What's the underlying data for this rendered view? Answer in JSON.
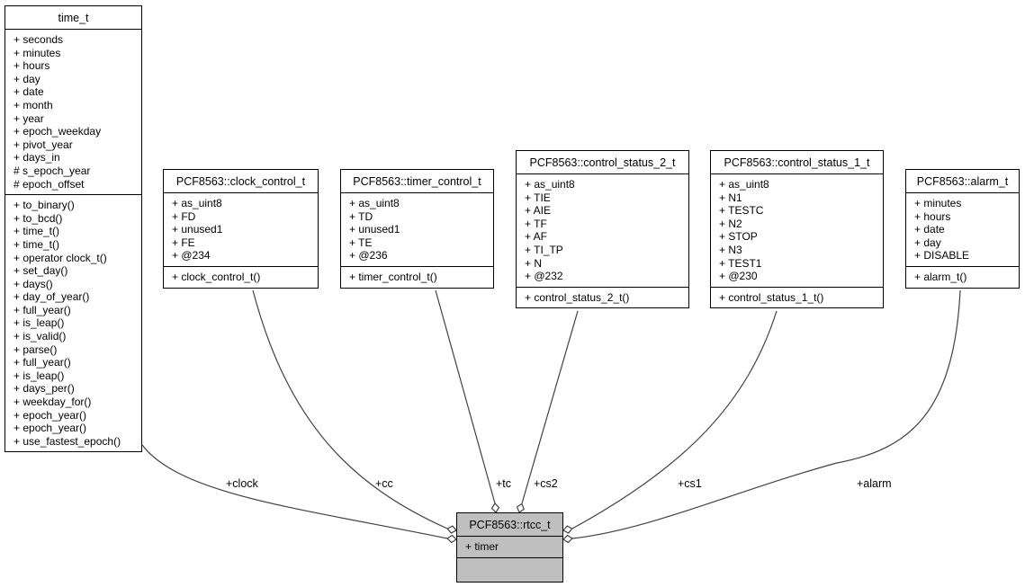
{
  "diagram": {
    "classes": [
      {
        "id": "time_t",
        "name": "time_t",
        "attributes": [
          "+ seconds",
          "+ minutes",
          "+ hours",
          "+ day",
          "+ date",
          "+ month",
          "+ year",
          "+ epoch_weekday",
          "+ pivot_year",
          "+ days_in",
          "# s_epoch_year",
          "# epoch_offset"
        ],
        "methods": [
          "+ to_binary()",
          "+ to_bcd()",
          "+ time_t()",
          "+ time_t()",
          "+ operator clock_t()",
          "+ set_day()",
          "+ days()",
          "+ day_of_year()",
          "+ full_year()",
          "+ is_leap()",
          "+ is_valid()",
          "+ parse()",
          "+ full_year()",
          "+ is_leap()",
          "+ days_per()",
          "+ weekday_for()",
          "+ epoch_year()",
          "+ epoch_year()",
          "+ use_fastest_epoch()"
        ]
      },
      {
        "id": "clock_control_t",
        "name": "PCF8563::clock_control_t",
        "attributes": [
          "+ as_uint8",
          "+ FD",
          "+ unused1",
          "+ FE",
          "+ @234"
        ],
        "methods": [
          "+ clock_control_t()"
        ]
      },
      {
        "id": "timer_control_t",
        "name": "PCF8563::timer_control_t",
        "attributes": [
          "+ as_uint8",
          "+ TD",
          "+ unused1",
          "+ TE",
          "+ @236"
        ],
        "methods": [
          "+ timer_control_t()"
        ]
      },
      {
        "id": "control_status_2_t",
        "name": "PCF8563::control_status_2_t",
        "attributes": [
          "+ as_uint8",
          "+ TIE",
          "+ AIE",
          "+ TF",
          "+ AF",
          "+ TI_TP",
          "+ N",
          "+ @232"
        ],
        "methods": [
          "+ control_status_2_t()"
        ]
      },
      {
        "id": "control_status_1_t",
        "name": "PCF8563::control_status_1_t",
        "attributes": [
          "+ as_uint8",
          "+ N1",
          "+ TESTC",
          "+ N2",
          "+ STOP",
          "+ N3",
          "+ TEST1",
          "+ @230"
        ],
        "methods": [
          "+ control_status_1_t()"
        ]
      },
      {
        "id": "alarm_t",
        "name": "PCF8563::alarm_t",
        "attributes": [
          "+ minutes",
          "+ hours",
          "+ date",
          "+ day",
          "+ DISABLE"
        ],
        "methods": [
          "+ alarm_t()"
        ]
      },
      {
        "id": "rtcc_t",
        "name": "PCF8563::rtcc_t",
        "attributes": [
          "+ timer"
        ],
        "methods": [],
        "highlighted": true
      }
    ],
    "edges": [
      {
        "from": "time_t",
        "to": "rtcc_t",
        "label": "+clock",
        "type": "composition"
      },
      {
        "from": "clock_control_t",
        "to": "rtcc_t",
        "label": "+cc",
        "type": "composition"
      },
      {
        "from": "timer_control_t",
        "to": "rtcc_t",
        "label": "+tc",
        "type": "composition"
      },
      {
        "from": "control_status_2_t",
        "to": "rtcc_t",
        "label": "+cs2",
        "type": "composition"
      },
      {
        "from": "control_status_1_t",
        "to": "rtcc_t",
        "label": "+cs1",
        "type": "composition"
      },
      {
        "from": "alarm_t",
        "to": "rtcc_t",
        "label": "+alarm",
        "type": "composition"
      }
    ],
    "colors": {
      "edge": "#404040",
      "focus_fill": "#bfbfbf",
      "box_fill": "#ffffff",
      "border": "#000000"
    }
  }
}
